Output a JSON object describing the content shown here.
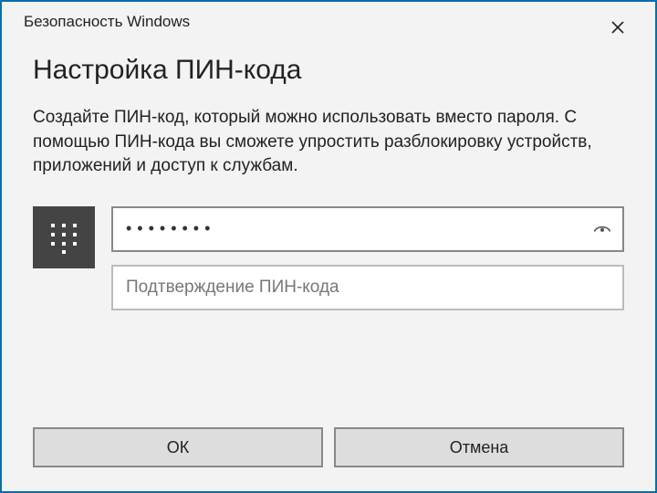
{
  "titlebar": {
    "title": "Безопасность Windows"
  },
  "content": {
    "heading": "Настройка ПИН-кода",
    "description": "Создайте ПИН-код, который можно использовать вместо пароля. С помощью ПИН-кода вы сможете упростить разблокировку устройств, приложений и доступ к службам."
  },
  "pin": {
    "masked_value": "••••••••",
    "confirm_placeholder": "Подтверждение ПИН-кода"
  },
  "footer": {
    "ok_label": "ОК",
    "cancel_label": "Отмена"
  },
  "icons": {
    "close": "close-icon",
    "keypad": "keypad-icon",
    "reveal": "eye-reveal-icon"
  }
}
